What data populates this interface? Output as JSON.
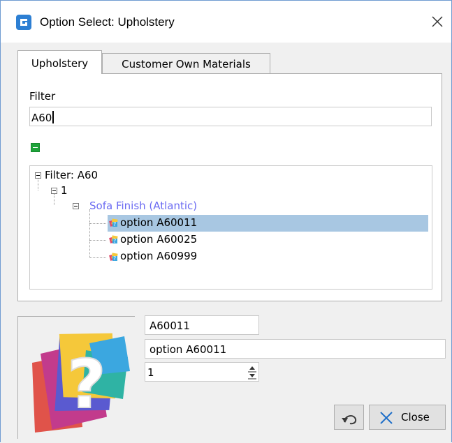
{
  "window": {
    "title": "Option Select: Upholstery",
    "app_icon": "app-logo-icon",
    "close_icon": "close-icon"
  },
  "tabs": [
    {
      "label": "Upholstery",
      "active": true
    },
    {
      "label": "Customer Own Materials",
      "active": false
    }
  ],
  "filter": {
    "label": "Filter",
    "value": "A60"
  },
  "collapse_icon": "collapse-minus-icon",
  "tree": {
    "root": "Filter: A60",
    "level1": "1",
    "group": "Sofa Finish (Atlantic)",
    "group_color": "#6b6bf2",
    "options": [
      "option A60011",
      "option A60025",
      "option A60999"
    ],
    "selected_index": 0,
    "selection_color": "#a8c7e2"
  },
  "detail": {
    "code": "A60011",
    "description": "option A60011",
    "quantity": "1",
    "preview_icon": "unknown-image-question-icon"
  },
  "buttons": {
    "undo_icon": "undo-icon",
    "close_label": "Close",
    "close_icon": "close-x-icon"
  }
}
